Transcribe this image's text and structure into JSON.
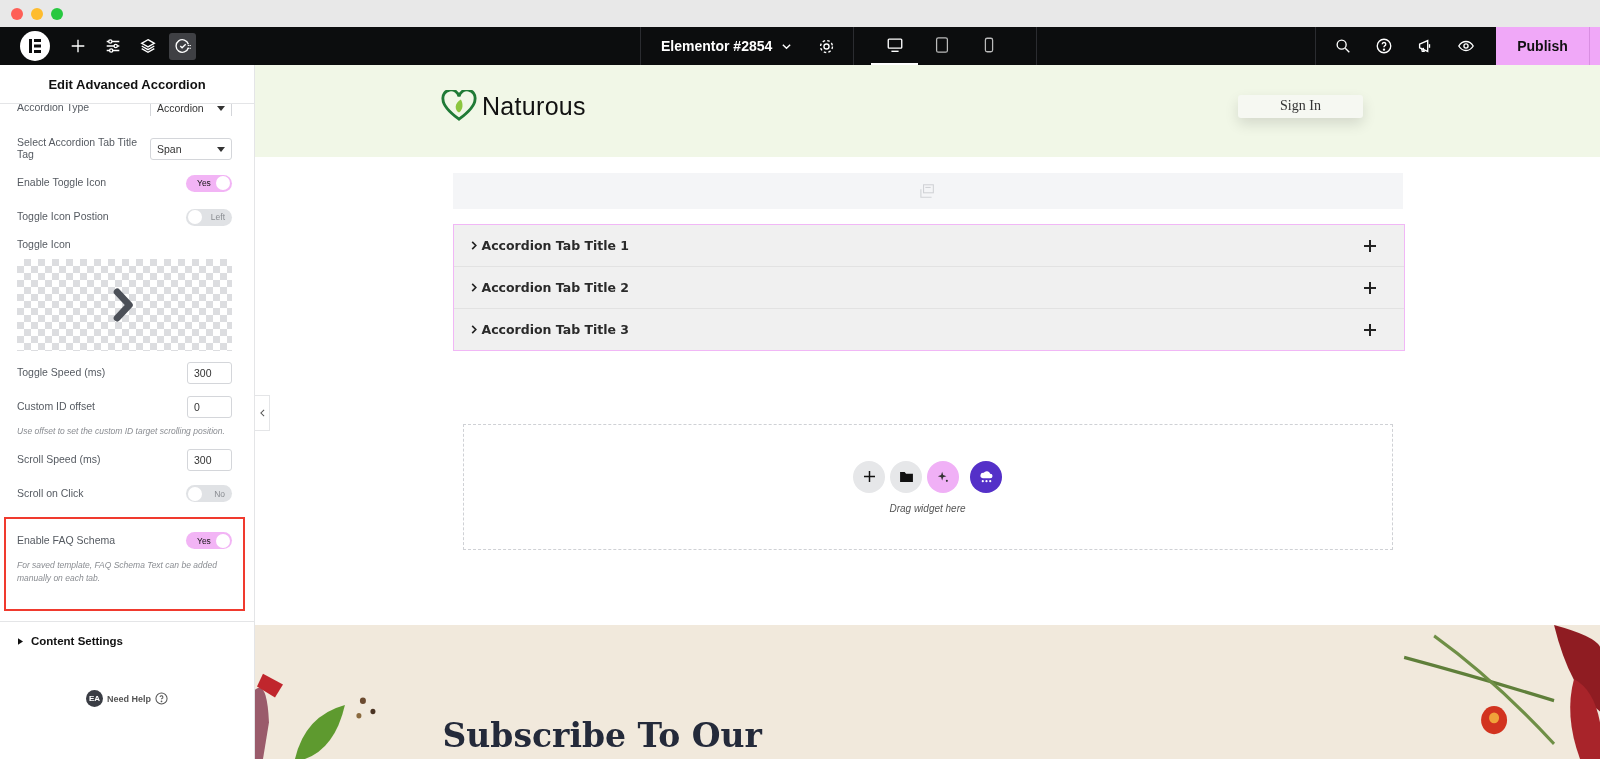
{
  "topbar": {
    "tools": [
      {
        "kind": "plus",
        "selected": false
      },
      {
        "kind": "sliders",
        "selected": false
      },
      {
        "kind": "layers",
        "selected": false
      },
      {
        "kind": "history",
        "selected": true
      }
    ],
    "document": {
      "title": "Elementor #2854"
    },
    "devices": [
      {
        "kind": "desktop",
        "selected": true
      },
      {
        "kind": "tablet",
        "selected": false
      },
      {
        "kind": "mobile",
        "selected": false
      }
    ],
    "actions": [
      {
        "kind": "search"
      },
      {
        "kind": "help"
      },
      {
        "kind": "announce"
      },
      {
        "kind": "preview"
      }
    ],
    "publish": "Publish"
  },
  "panel": {
    "title": "Edit Advanced Accordion",
    "controls": [
      {
        "kind": "select",
        "label": "Accordion Type",
        "value": "Accordion",
        "clipped": true,
        "highlighted": false
      },
      {
        "kind": "select",
        "label": "Select Accordion Tab Title Tag",
        "value": "Span",
        "clipped": false,
        "highlighted": false
      },
      {
        "kind": "switch",
        "label": "Enable Toggle Icon",
        "on": true,
        "state_text": "Yes",
        "clipped": false,
        "highlighted": false
      },
      {
        "kind": "switch",
        "label": "Toggle Icon Postion",
        "on": false,
        "state_text": "Left",
        "clipped": false,
        "highlighted": false
      },
      {
        "kind": "icon",
        "label": "Toggle Icon",
        "clipped": false,
        "highlighted": false
      },
      {
        "kind": "number",
        "label": "Toggle Speed (ms)",
        "value": "300",
        "clipped": false,
        "highlighted": false
      },
      {
        "kind": "number",
        "label": "Custom ID offset",
        "value": "0",
        "note": "Use offset to set the custom ID target scrolling position.",
        "clipped": false,
        "highlighted": false
      },
      {
        "kind": "number",
        "label": "Scroll Speed (ms)",
        "value": "300",
        "clipped": false,
        "highlighted": false
      },
      {
        "kind": "switch",
        "label": "Scroll on Click",
        "on": false,
        "state_text": "No",
        "clipped": false,
        "highlighted": false
      },
      {
        "kind": "switch",
        "label": "Enable FAQ Schema",
        "on": true,
        "state_text": "Yes",
        "note": "For saved template, FAQ Schema Text can be added manually on each tab.",
        "clipped": false,
        "highlighted": true
      }
    ],
    "section": {
      "title": "Content Settings",
      "expanded": false
    },
    "help": {
      "badge": "EA",
      "label": "Need Help"
    }
  },
  "page": {
    "brand": "Naturous",
    "sign_in": "Sign In",
    "accordion": [
      {
        "title": "Accordion Tab Title 1"
      },
      {
        "title": "Accordion Tab Title 2"
      },
      {
        "title": "Accordion Tab Title 3"
      }
    ],
    "dropzone": {
      "hint": "Drag widget here"
    },
    "subscribe": {
      "heading": "Subscribe To Our"
    }
  }
}
